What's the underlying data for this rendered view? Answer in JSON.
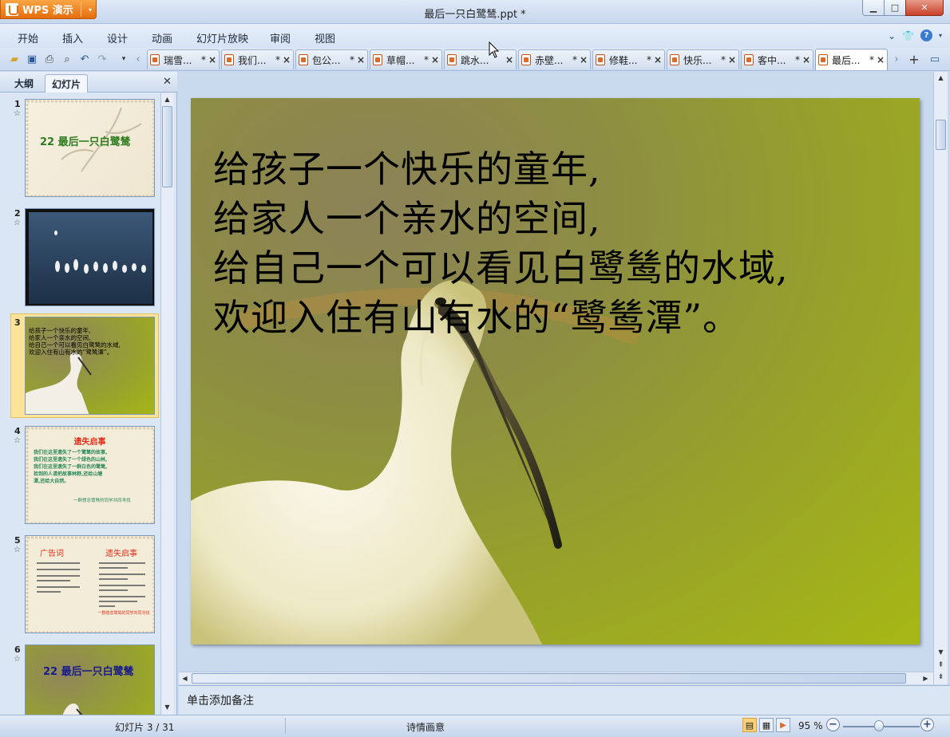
{
  "app": {
    "name": "WPS 演示",
    "document_title": "最后一只白鹭鸶.ppt *"
  },
  "menu": [
    "开始",
    "插入",
    "设计",
    "动画",
    "幻灯片放映",
    "审阅",
    "视图"
  ],
  "tabs": [
    {
      "label": "瑞雪...",
      "modified": "*"
    },
    {
      "label": "我们...",
      "modified": "*"
    },
    {
      "label": "包公...",
      "modified": "*"
    },
    {
      "label": "草帽...",
      "modified": "*"
    },
    {
      "label": "跳水...",
      "modified": ""
    },
    {
      "label": "赤壁...",
      "modified": "*"
    },
    {
      "label": "修鞋...",
      "modified": "*"
    },
    {
      "label": "快乐...",
      "modified": "*"
    },
    {
      "label": "客中...",
      "modified": "*"
    },
    {
      "label": "最后...",
      "modified": "*"
    }
  ],
  "active_tab_index": 9,
  "panel": {
    "tabs": [
      "大纲",
      "幻灯片"
    ],
    "active": "幻灯片"
  },
  "thumbnails": [
    {
      "num": "1",
      "title": "22 最后一只白鹭鸶"
    },
    {
      "num": "2"
    },
    {
      "num": "3",
      "lines": [
        "给孩子一个快乐的童年,",
        "给家人一个亲水的空间,",
        "给自己一个可以看见白鹭鸶的水域,",
        "欢迎入住有山有水的“鹭鸶潭”。"
      ]
    },
    {
      "num": "4",
      "title": "遗失启事",
      "lines": [
        "我们在这里遗失了一个鹭鸶的故事,",
        "我们在这里遗失了一个绿色的山林,",
        "我们在这里遗失了一群白色的鹭鸶,",
        "拾到的人请把故事林野,还给山塘",
        "潭,还给大自然。"
      ],
      "sign": "一群想念鹭鸶的同学共同寻找"
    },
    {
      "num": "5",
      "left_title": "广告词",
      "right_title": "遗失启事",
      "sign": "一群想念鹭鸶的同学共同寻找"
    },
    {
      "num": "6",
      "title": "22 最后一只白鹭鸶"
    }
  ],
  "slide": {
    "lines": [
      "给孩子一个快乐的童年,",
      "给家人一个亲水的空间,",
      "给自己一个可以看见白鹭鸶的水域,",
      "欢迎入住有山有水的“鹭鸶潭”。"
    ]
  },
  "notes_placeholder": "单击添加备注",
  "status": {
    "slide_counter": "幻灯片 3 / 31",
    "theme": "诗情画意",
    "zoom": "95 %"
  },
  "colors": {
    "accent": "#e56d0c",
    "chrome": "#c9d9ee"
  }
}
